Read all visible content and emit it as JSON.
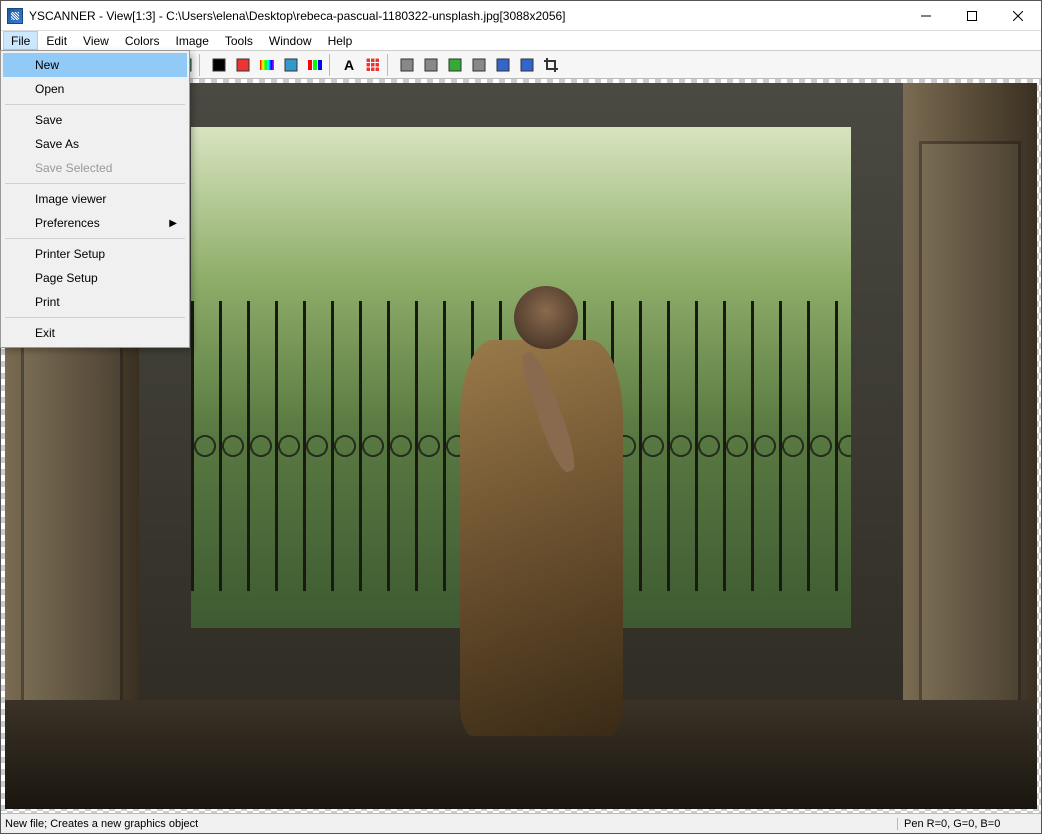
{
  "titlebar": {
    "title": "YSCANNER - View[1:3] - C:\\Users\\elena\\Desktop\\rebeca-pascual-1180322-unsplash.jpg[3088x2056]"
  },
  "menubar": {
    "items": [
      {
        "label": "File",
        "active": true
      },
      {
        "label": "Edit"
      },
      {
        "label": "View"
      },
      {
        "label": "Colors"
      },
      {
        "label": "Image"
      },
      {
        "label": "Tools"
      },
      {
        "label": "Window"
      },
      {
        "label": "Help"
      }
    ]
  },
  "file_menu": {
    "items": [
      {
        "label": "New",
        "highlighted": true
      },
      {
        "label": "Open"
      },
      {
        "sep": true
      },
      {
        "label": "Save"
      },
      {
        "label": "Save As"
      },
      {
        "label": "Save Selected",
        "disabled": true
      },
      {
        "sep": true
      },
      {
        "label": "Image viewer"
      },
      {
        "label": "Preferences",
        "submenu": true
      },
      {
        "sep": true
      },
      {
        "label": "Printer Setup"
      },
      {
        "label": "Page Setup"
      },
      {
        "label": "Print"
      },
      {
        "sep": true
      },
      {
        "label": "Exit"
      }
    ]
  },
  "toolbar": {
    "buttons": [
      {
        "name": "new-icon"
      },
      {
        "name": "open-icon"
      },
      {
        "name": "save-icon"
      },
      {
        "name": "print-icon"
      },
      {
        "name": "cut-icon"
      },
      {
        "name": "copy-icon"
      },
      {
        "name": "paste-icon"
      },
      {
        "name": "undo-icon"
      },
      {
        "sep": true
      },
      {
        "name": "monitor-icon"
      },
      {
        "name": "palette-icon"
      },
      {
        "name": "gradient-icon"
      },
      {
        "name": "window-icon"
      },
      {
        "name": "rgb-icon"
      },
      {
        "sep": true
      },
      {
        "name": "text-icon"
      },
      {
        "name": "grid-icon"
      },
      {
        "sep": true
      },
      {
        "name": "select-icon"
      },
      {
        "name": "magnify-icon"
      },
      {
        "name": "pencil-icon"
      },
      {
        "name": "eye-icon"
      },
      {
        "name": "fill-icon"
      },
      {
        "name": "camera-icon"
      },
      {
        "name": "crop-icon"
      }
    ]
  },
  "statusbar": {
    "text": "New file; Creates a new graphics object",
    "pen": "Pen R=0, G=0, B=0"
  }
}
